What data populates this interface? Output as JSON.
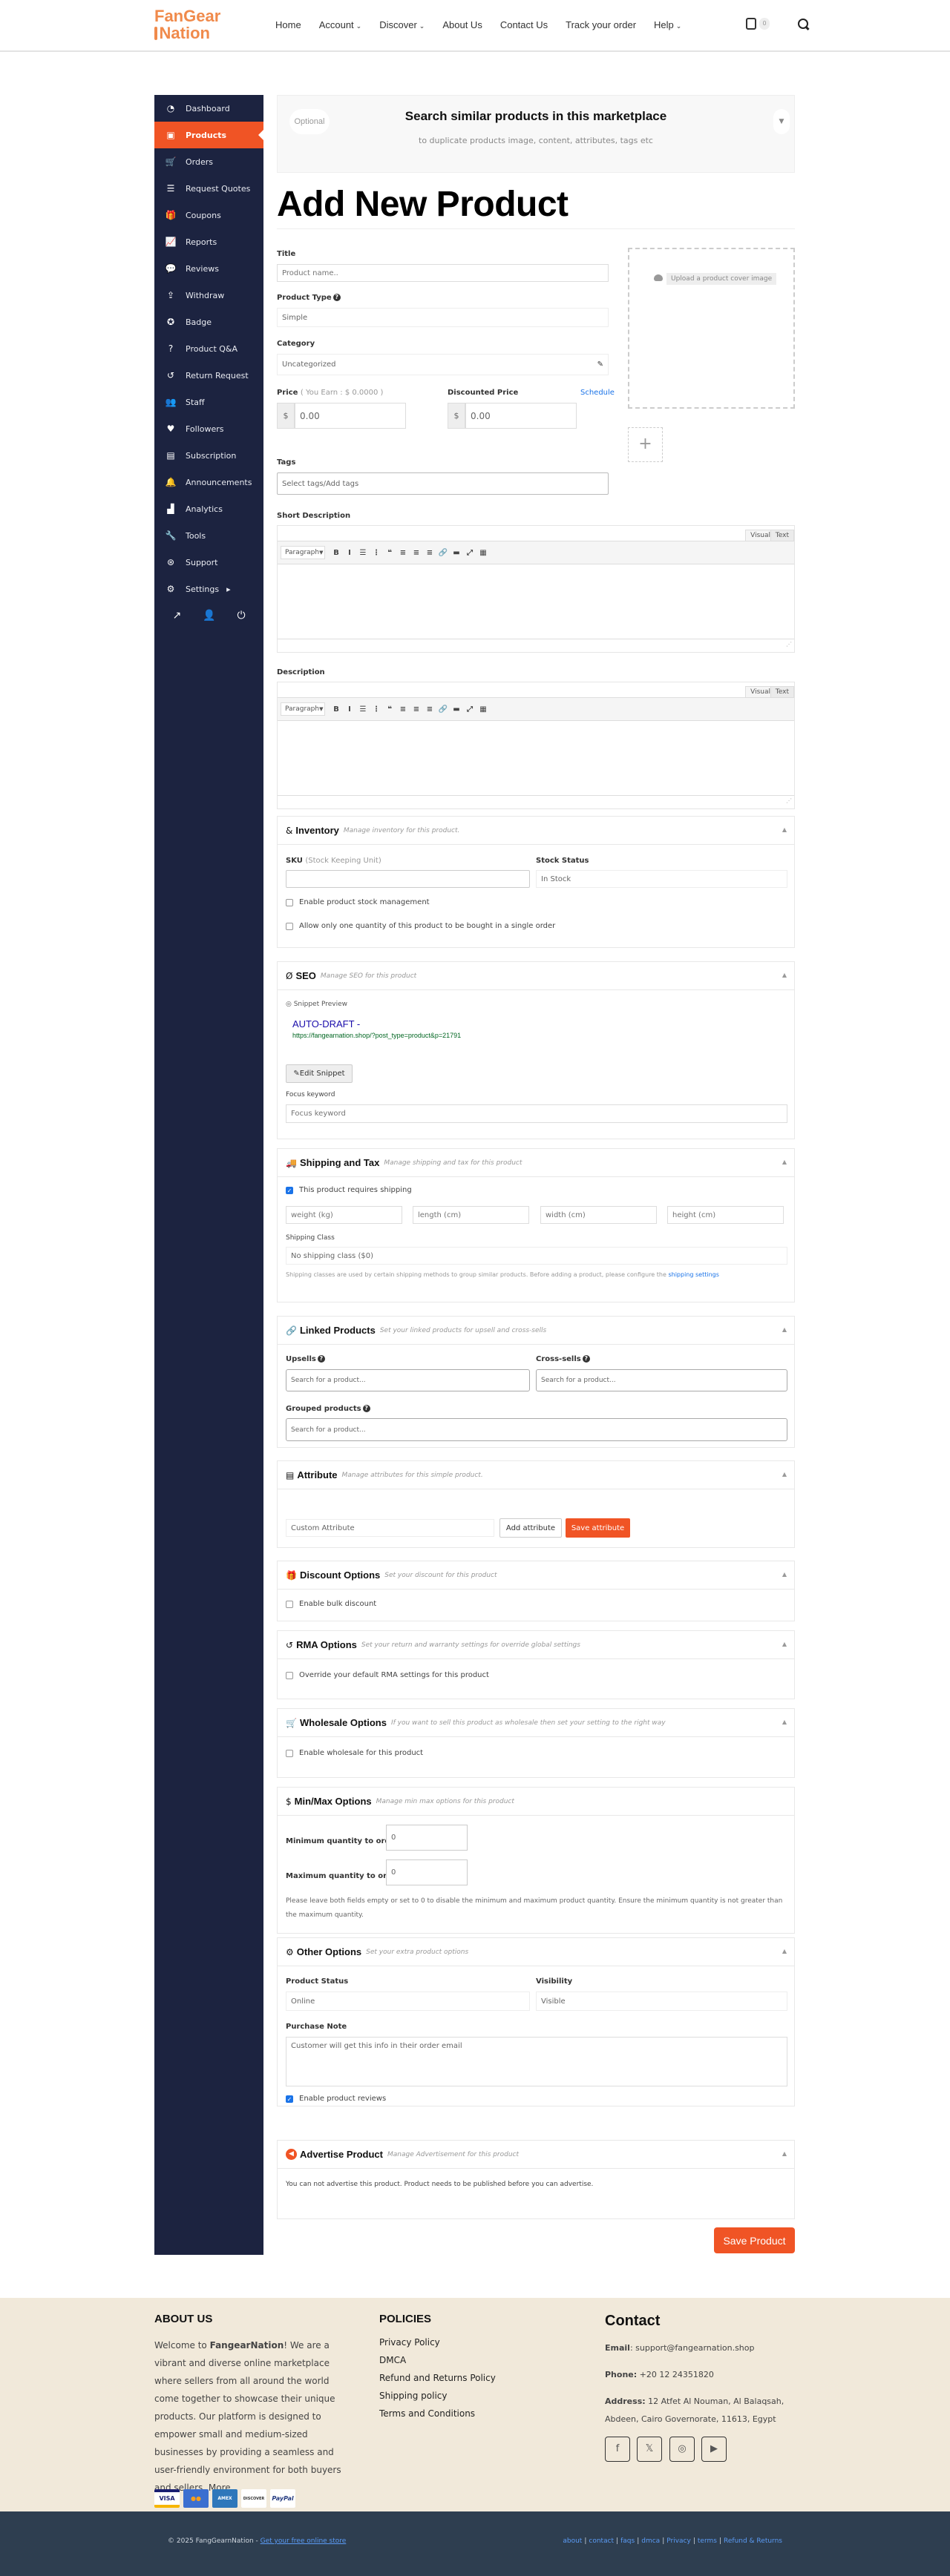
{
  "header": {
    "logo_line1": "FanGear",
    "logo_line2": "Nation",
    "nav": [
      {
        "label": "Home",
        "dropdown": false
      },
      {
        "label": "Account",
        "dropdown": true
      },
      {
        "label": "Discover",
        "dropdown": true
      },
      {
        "label": "About Us",
        "dropdown": false
      },
      {
        "label": "Contact Us",
        "dropdown": false
      },
      {
        "label": "Track your order",
        "dropdown": false
      },
      {
        "label": "Help",
        "dropdown": true
      }
    ],
    "cart_count": "0",
    "caret": "⌄"
  },
  "sidebar": {
    "items": [
      {
        "label": "Dashboard",
        "icon": "◔"
      },
      {
        "label": "Products",
        "icon": "▣",
        "active": true
      },
      {
        "label": "Orders",
        "icon": "🛒"
      },
      {
        "label": "Request Quotes",
        "icon": "☰"
      },
      {
        "label": "Coupons",
        "icon": "🎁"
      },
      {
        "label": "Reports",
        "icon": "📈"
      },
      {
        "label": "Reviews",
        "icon": "💬"
      },
      {
        "label": "Withdraw",
        "icon": "⇪"
      },
      {
        "label": "Badge",
        "icon": "✪"
      },
      {
        "label": "Product Q&A",
        "icon": "?"
      },
      {
        "label": "Return Request",
        "icon": "↺"
      },
      {
        "label": "Staff",
        "icon": "👥"
      },
      {
        "label": "Followers",
        "icon": "♥"
      },
      {
        "label": "Subscription",
        "icon": "▤"
      },
      {
        "label": "Announcements",
        "icon": "🔔"
      },
      {
        "label": "Analytics",
        "icon": "▟"
      },
      {
        "label": "Tools",
        "icon": "🔧"
      },
      {
        "label": "Support",
        "icon": "⊛"
      },
      {
        "label": "Settings",
        "icon": "⚙",
        "arrow": "▸"
      }
    ],
    "footer_icons": {
      "external": "↗",
      "profile": "👤",
      "logout": "⏻"
    }
  },
  "search_similar": {
    "optional": "Optional",
    "title": "Search similar products in this marketplace",
    "subtitle": "to duplicate products image, content, attributes, tags etc",
    "toggle": "▼"
  },
  "page_title": "Add New Product",
  "form": {
    "title_label": "Title",
    "title_placeholder": "Product name..",
    "product_type_label": "Product Type",
    "product_type_value": "Simple",
    "category_label": "Category",
    "category_value": "Uncategorized",
    "price_label": "Price",
    "price_earn": "( You Earn : $ 0.0000 )",
    "price_value": "0.00",
    "currency": "$",
    "discount_label": "Discounted Price",
    "discount_value": "0.00",
    "schedule_link": "Schedule",
    "tags_label": "Tags",
    "tags_placeholder": "Select tags/Add tags",
    "cover_upload": "Upload a product cover image",
    "gallery_add": "+",
    "short_desc_label": "Short Description",
    "desc_label": "Description",
    "editor": {
      "tab_visual": "Visual",
      "tab_text": "Text",
      "format": "Paragraph",
      "buttons": [
        "B",
        "I",
        "☰",
        "⋮",
        "❝",
        "≡",
        "≡",
        "≡",
        "🔗",
        "▬",
        "⤢",
        "▦"
      ]
    }
  },
  "inventory": {
    "title": "Inventory",
    "subtitle": "Manage inventory for this product.",
    "sku_label": "SKU",
    "sku_hint": "(Stock Keeping Unit)",
    "sku_value": "",
    "stock_label": "Stock Status",
    "stock_value": "In Stock",
    "cb_manage": "Enable product stock management",
    "cb_single": "Allow only one quantity of this product to be bought in a single order"
  },
  "seo": {
    "title": "SEO",
    "subtitle": "Manage SEO for this product",
    "snippet_label": "Snippet Preview",
    "snippet_title": "AUTO-DRAFT -",
    "snippet_url": "https://fangearnation.shop/?post_type=product&p=21791",
    "edit_snippet": "Edit Snippet",
    "focus_label": "Focus keyword",
    "focus_placeholder": "Focus keyword"
  },
  "shipping": {
    "title": "Shipping and Tax",
    "subtitle": "Manage shipping and tax for this product",
    "requires_shipping": "This product requires shipping",
    "requires_checked": true,
    "weight": "weight (kg)",
    "length": "length (cm)",
    "width": "width (cm)",
    "height": "height (cm)",
    "class_label": "Shipping Class",
    "class_value": "No shipping class ($0)",
    "help": "Shipping classes are used by certain shipping methods to group similar products. Before adding a product, please configure the",
    "help_link": "shipping settings"
  },
  "linked": {
    "title": "Linked Products",
    "subtitle": "Set your linked products for upsell and cross-sells",
    "upsells_label": "Upsells",
    "crosssells_label": "Cross-sells",
    "grouped_label": "Grouped products",
    "search_placeholder": "Search for a product..."
  },
  "attribute": {
    "title": "Attribute",
    "subtitle": "Manage attributes for this simple product.",
    "custom_value": "Custom Attribute",
    "add_button": "Add attribute",
    "save_button": "Save attribute"
  },
  "discount": {
    "title": "Discount Options",
    "subtitle": "Set your discount for this product",
    "cb_bulk": "Enable bulk discount"
  },
  "rma": {
    "title": "RMA Options",
    "subtitle": "Set your return and warranty settings for override global settings",
    "cb_override": "Override your default RMA settings for this product"
  },
  "wholesale": {
    "title": "Wholesale Options",
    "subtitle": "If you want to sell this product as wholesale then set your setting to the right way",
    "cb_enable": "Enable wholesale for this product"
  },
  "minmax": {
    "title": "Min/Max Options",
    "subtitle": "Manage min max options for this product",
    "min_label": "Minimum quantity to order",
    "min_value": "0",
    "max_label": "Maximum quantity to order",
    "max_value": "0",
    "help": "Please leave both fields empty or set to 0 to disable the minimum and maximum product quantity. Ensure the minimum quantity is not greater than the maximum quantity."
  },
  "other": {
    "title": "Other Options",
    "subtitle": "Set your extra product options",
    "status_label": "Product Status",
    "status_value": "Online",
    "visibility_label": "Visibility",
    "visibility_value": "Visible",
    "note_label": "Purchase Note",
    "note_value": "Customer will get this info in their order email",
    "cb_reviews": "Enable product reviews",
    "reviews_checked": true
  },
  "advertise": {
    "title": "Advertise Product",
    "subtitle": "Manage Advertisement for this product",
    "message": "You can not advertise this product. Product needs to be published before you can advertise."
  },
  "save_product": "Save Product",
  "footer": {
    "about_title": "ABOUT US",
    "about_prefix": "Welcome to ",
    "about_brand": "FangearNation",
    "about_text": "! We are a vibrant and diverse online marketplace where sellers from all around the world come together to showcase their unique products. Our platform is designed to empower small and medium-sized businesses by providing a seamless and user-friendly environment for both buyers and sellers. More",
    "payments": [
      "VISA",
      "MC",
      "AMEX",
      "DISCOVER",
      "PayPal"
    ],
    "policies_title": "POLICIES",
    "policies": [
      "Privacy Policy",
      "DMCA",
      "Refund and Returns Policy",
      "Shipping policy",
      "Terms and Conditions"
    ],
    "contact_title": "Contact",
    "email_label": "Email",
    "email_value": ": support@fangearnation.shop",
    "phone_label": "Phone:",
    "phone_value": " +20 12 24351820",
    "address_label": "Address:",
    "address_value": " 12 Atfet Al Nouman, Al Balaqsah, Abdeen, Cairo Governorate, 11613, Egypt",
    "social": [
      "f",
      "𝕏",
      "◎",
      "▶"
    ]
  },
  "bottom": {
    "copyright": "© 2025 FangGearnNation - ",
    "store_link": "Get your free online store",
    "links": [
      "about",
      "contact",
      "faqs",
      "dmca",
      "Privacy",
      "terms",
      "Refund & Returns"
    ]
  },
  "colors": {
    "accent": "#f05425",
    "sidebar": "#1c2340",
    "logo": "#f08a4b",
    "link": "#1a73e8",
    "footer_bg": "#f1e9da",
    "bottom_bg": "#2e3e50"
  }
}
